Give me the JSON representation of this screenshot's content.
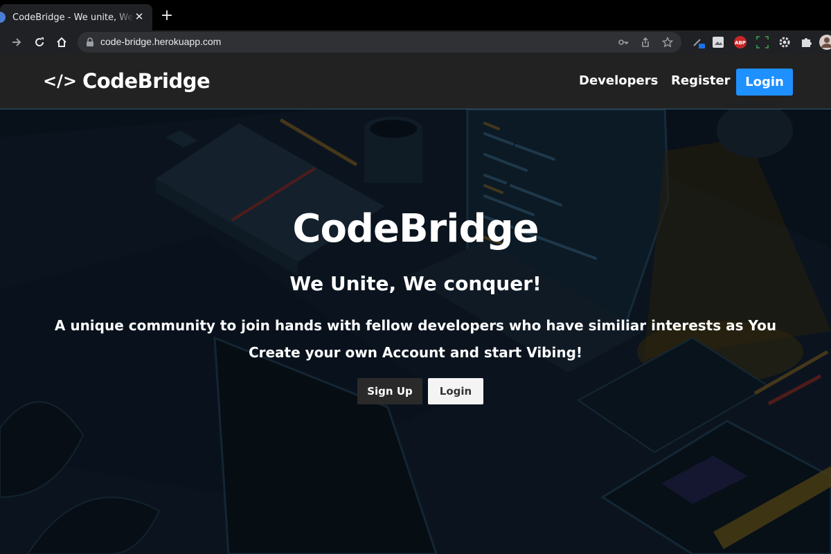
{
  "browser": {
    "tab_title": "CodeBridge - We unite, We conquer!",
    "url": "code-bridge.herokuapp.com",
    "new_tab_symbol": "+",
    "close_symbol": "✕",
    "extension_abp": "ABP"
  },
  "navbar": {
    "brand_icon": "</>",
    "brand_name": "CodeBridge",
    "links": [
      "Developers",
      "Register"
    ],
    "login": "Login"
  },
  "hero": {
    "title": "CodeBridge",
    "tagline": "We Unite, We conquer!",
    "description": "A unique community to join hands with fellow developers who have similiar interests as You",
    "cta_text": "Create your own Account and start Vibing!",
    "signup_button": "Sign Up",
    "login_button": "Login"
  },
  "colors": {
    "primary": "#1e90ff",
    "navbar_bg": "#232222",
    "hero_bg": "#0e1a26",
    "signup_bg": "#2b2a2a"
  }
}
